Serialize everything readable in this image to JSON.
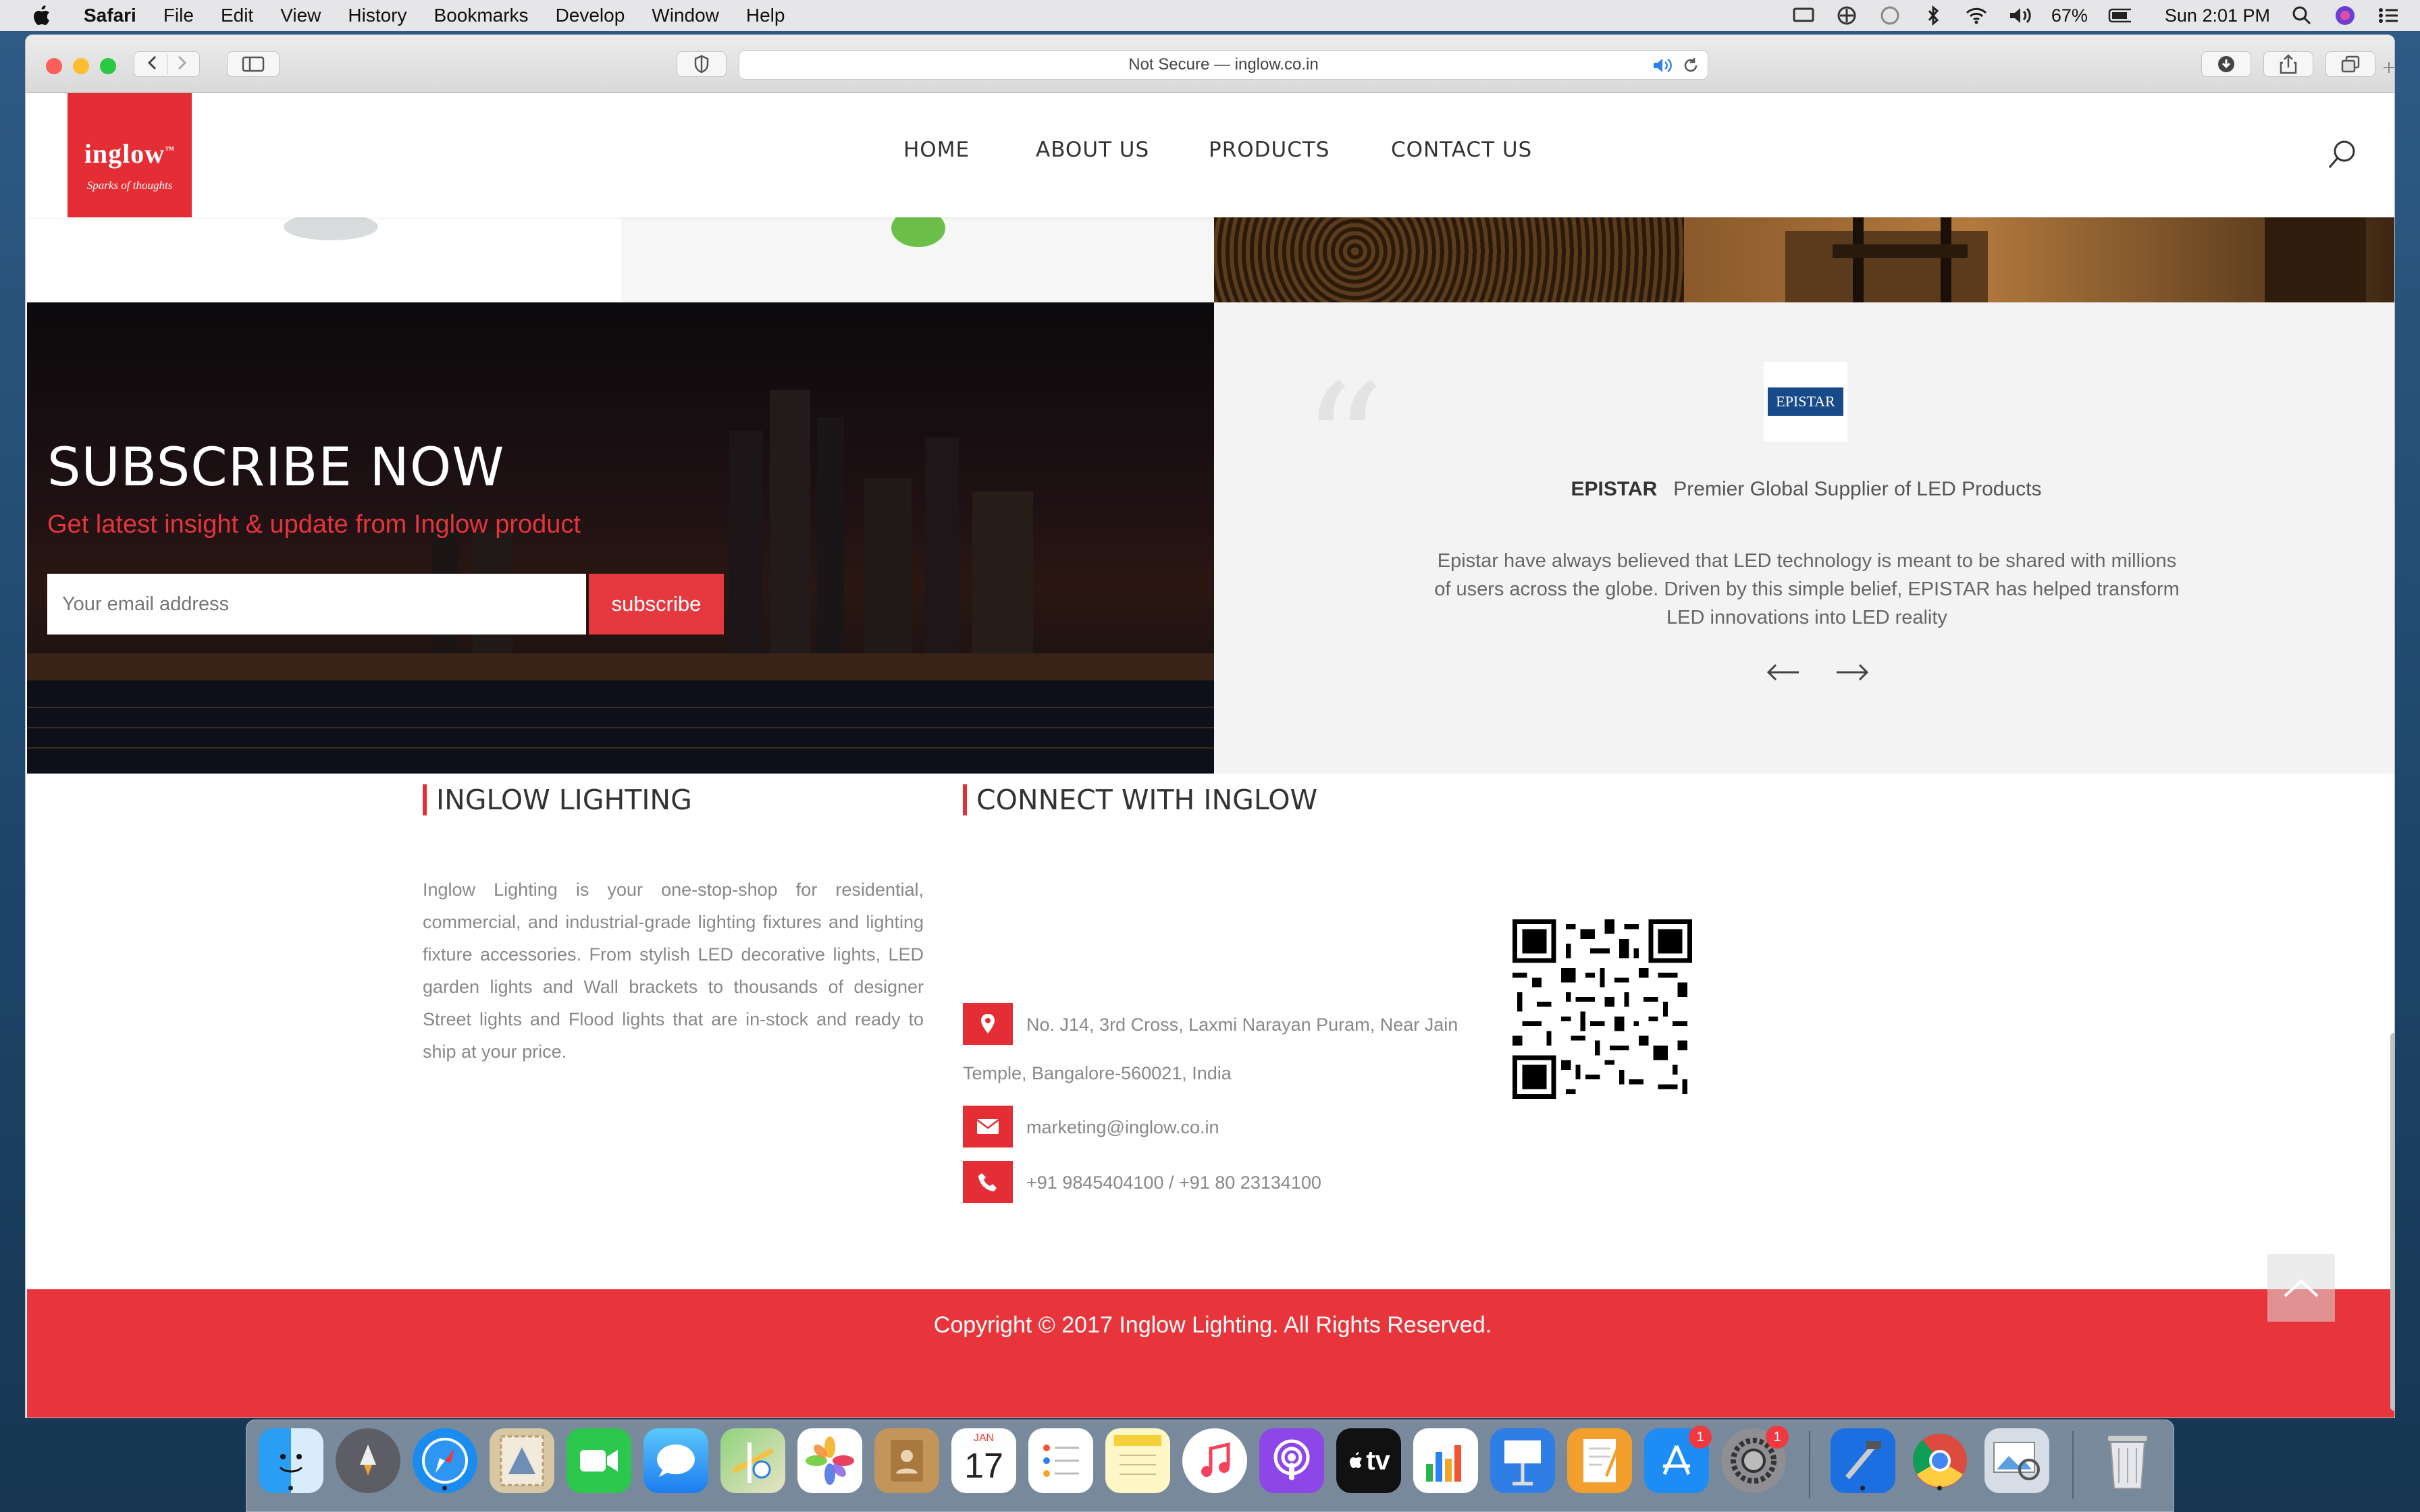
{
  "menubar": {
    "app": "Safari",
    "items": [
      "File",
      "Edit",
      "View",
      "History",
      "Bookmarks",
      "Develop",
      "Window",
      "Help"
    ],
    "battery": "67%",
    "clock": "Sun 2:01 PM"
  },
  "browser": {
    "address": "Not Secure — inglow.co.in"
  },
  "site": {
    "logo_brand": "inglow",
    "logo_tm": "™",
    "logo_tagline": "Sparks of thoughts",
    "nav": [
      "HOME",
      "ABOUT US",
      "PRODUCTS",
      "CONTACT US"
    ]
  },
  "subscribe": {
    "title": "SUBSCRIBE NOW",
    "subtitle": "Get latest insight & update from Inglow product",
    "placeholder": "Your email address",
    "button": "subscribe"
  },
  "testimonial": {
    "logo_text": "EPISTAR",
    "name": "EPISTAR",
    "role": "Premier Global Supplier of LED Products",
    "body": "Epistar have always believed that LED technology is meant to be shared with millions of users across the globe. Driven by this simple belief, EPISTAR has helped transform LED innovations into LED reality"
  },
  "footer": {
    "about_heading": "INGLOW LIGHTING",
    "about_text": "Inglow Lighting is your one-stop-shop for residential, commercial, and industrial-grade lighting fixtures and lighting fixture accessories. From stylish LED decorative lights, LED garden lights and Wall brackets to thousands of designer Street lights and Flood lights that are in-stock and ready to ship at your price.",
    "connect_heading": "CONNECT WITH INGLOW",
    "address_line1": "No. J14, 3rd Cross, Laxmi Narayan Puram, Near Jain",
    "address_line2": "Temple, Bangalore-560021, India",
    "email": "marketing@inglow.co.in",
    "phone": "+91 9845404100 / +91 80 23134100",
    "copyright": "Copyright © 2017 Inglow Lighting. All Rights Reserved."
  },
  "dock": {
    "calendar_month": "JAN",
    "calendar_day": "17",
    "appstore_badge": "1",
    "prefs_badge": "1",
    "tv_label": "tv"
  },
  "colors": {
    "brand_red": "#e52d35",
    "menu_bg": "#e6e6e8"
  }
}
